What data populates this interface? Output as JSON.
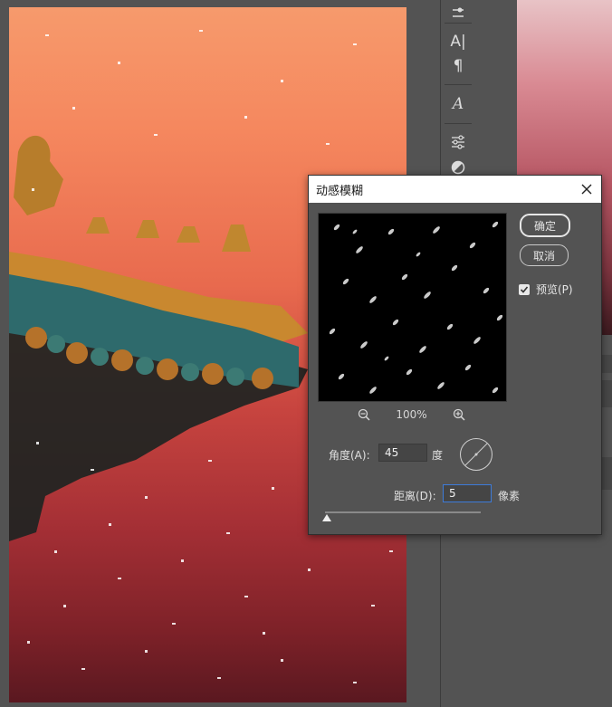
{
  "dialog": {
    "title": "动感模糊",
    "ok_label": "确定",
    "cancel_label": "取消",
    "preview_label": "预览(P)",
    "preview_checked": true,
    "zoom_level": "100%",
    "angle_label": "角度(A):",
    "angle_value": "45",
    "angle_unit": "度",
    "distance_label": "距离(D):",
    "distance_value": "5",
    "distance_unit": "像素"
  },
  "toolbar": {
    "items": [
      {
        "icon": "adjust-icon"
      },
      {
        "icon": "character-icon",
        "label": "A|"
      },
      {
        "icon": "paragraph-icon",
        "label": "¶"
      },
      {
        "icon": "glyphs-icon",
        "label": "A"
      },
      {
        "icon": "properties-icon"
      },
      {
        "icon": "circle-half-icon"
      }
    ]
  },
  "colors": {
    "dialog_bg": "#535353",
    "focus_border": "#3d7bd9"
  }
}
